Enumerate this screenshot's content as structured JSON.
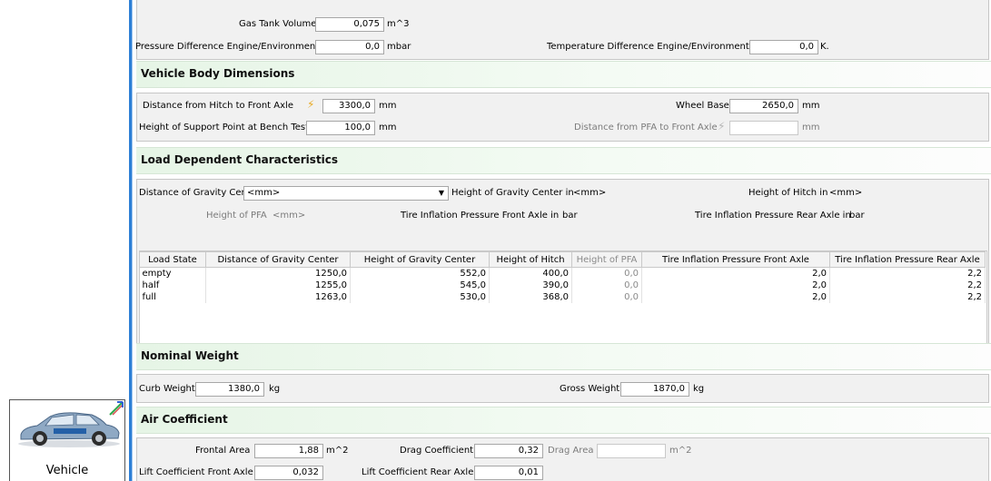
{
  "left_widget": {
    "label": "Vehicle",
    "icon": "car-icon"
  },
  "top": {
    "gas_tank_label": "Gas Tank Volume",
    "gas_tank_value": "0,075",
    "gas_tank_unit": "m^3",
    "pressure_diff_label": "Pressure Difference Engine/Environment",
    "pressure_diff_value": "0,0",
    "pressure_diff_unit": "mbar",
    "temp_diff_label": "Temperature Difference Engine/Environment",
    "temp_diff_value": "0,0",
    "temp_diff_unit": "K."
  },
  "body_dims": {
    "title": "Vehicle Body Dimensions",
    "hitch_front_label": "Distance from Hitch to Front Axle",
    "hitch_front_value": "3300,0",
    "hitch_front_unit": "mm",
    "wheel_base_label": "Wheel Base",
    "wheel_base_value": "2650,0",
    "wheel_base_unit": "mm",
    "support_label": "Height of Support Point at Bench Test",
    "support_value": "100,0",
    "support_unit": "mm",
    "pfa_front_label": "Distance from PFA to Front Axle",
    "pfa_front_value": "",
    "pfa_front_unit": "mm"
  },
  "load": {
    "title": "Load Dependent Characteristics",
    "dist_gc_label": "Distance of Gravity Center in",
    "dist_gc_unit": "<mm>",
    "height_gc_label": "Height of Gravity Center in",
    "height_gc_unit": "<mm>",
    "height_hitch_label": "Height of Hitch in",
    "height_hitch_unit": "<mm>",
    "height_pfa_label": "Height of PFA",
    "height_pfa_unit": "<mm>",
    "tire_front_label": "Tire Inflation Pressure Front Axle in",
    "tire_front_unit": "bar",
    "tire_rear_label": "Tire Inflation Pressure Rear Axle in",
    "tire_rear_unit": "bar",
    "columns": [
      "Load State",
      "Distance of Gravity Center",
      "Height of Gravity Center",
      "Height of Hitch",
      "Height of PFA",
      "Tire Inflation Pressure Front Axle",
      "Tire Inflation Pressure Rear Axle"
    ],
    "rows": [
      [
        "empty",
        "1250,0",
        "552,0",
        "400,0",
        "0,0",
        "2,0",
        "2,2"
      ],
      [
        "half",
        "1255,0",
        "545,0",
        "390,0",
        "0,0",
        "2,0",
        "2,2"
      ],
      [
        "full",
        "1263,0",
        "530,0",
        "368,0",
        "0,0",
        "2,0",
        "2,2"
      ]
    ]
  },
  "weight": {
    "title": "Nominal Weight",
    "curb_label": "Curb Weight",
    "curb_value": "1380,0",
    "curb_unit": "kg",
    "gross_label": "Gross Weight",
    "gross_value": "1870,0",
    "gross_unit": "kg"
  },
  "air": {
    "title": "Air Coefficient",
    "frontal_label": "Frontal Area",
    "frontal_value": "1,88",
    "frontal_unit": "m^2",
    "drag_label": "Drag Coefficient",
    "drag_value": "0,32",
    "drag_area_label": "Drag Area",
    "drag_area_value": "",
    "drag_area_unit": "m^2",
    "lift_front_label": "Lift Coefficient Front Axle",
    "lift_front_value": "0,032",
    "lift_rear_label": "Lift Coefficient Rear Axle",
    "lift_rear_value": "0,01"
  }
}
